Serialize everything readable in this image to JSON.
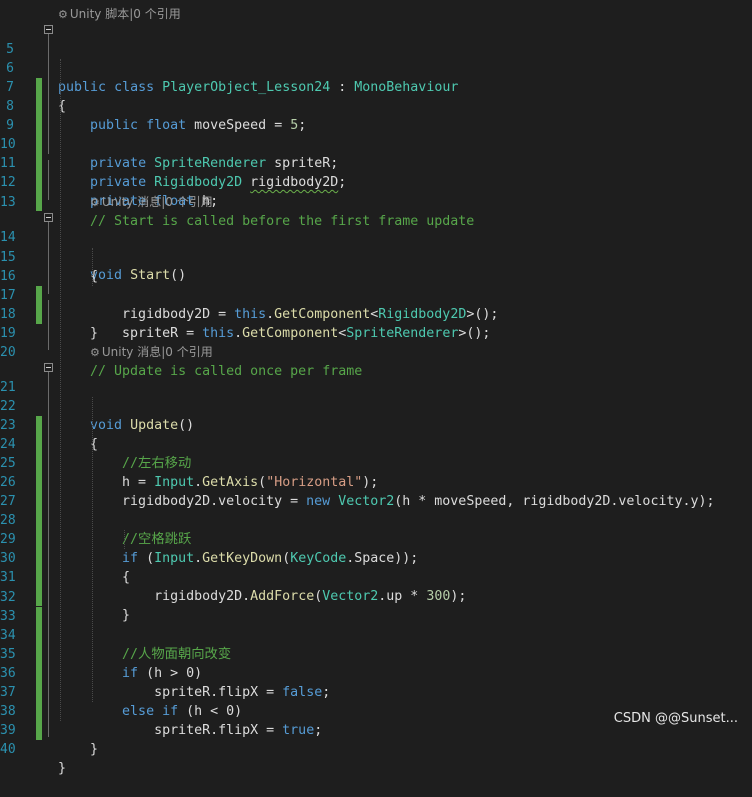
{
  "editor": {
    "lens_class": "Unity 脚本|0 个引用",
    "lens_start": "Unity 消息|0 个引用",
    "lens_update": "Unity 消息|0 个引用",
    "lines": [
      {
        "n": "5"
      },
      {
        "n": "6"
      },
      {
        "n": "7"
      },
      {
        "n": "8"
      },
      {
        "n": "9"
      },
      {
        "n": "10"
      },
      {
        "n": "11"
      },
      {
        "n": "12"
      },
      {
        "n": "13"
      },
      {
        "n": "14"
      },
      {
        "n": "15"
      },
      {
        "n": "16"
      },
      {
        "n": "17"
      },
      {
        "n": "18"
      },
      {
        "n": "19"
      },
      {
        "n": "20"
      },
      {
        "n": "21"
      },
      {
        "n": "22"
      },
      {
        "n": "23"
      },
      {
        "n": "24"
      },
      {
        "n": "25"
      },
      {
        "n": "26"
      },
      {
        "n": "27"
      },
      {
        "n": "28"
      },
      {
        "n": "29"
      },
      {
        "n": "30"
      },
      {
        "n": "31"
      },
      {
        "n": "32"
      },
      {
        "n": "33"
      },
      {
        "n": "34"
      },
      {
        "n": "35"
      },
      {
        "n": "36"
      },
      {
        "n": "37"
      },
      {
        "n": "38"
      },
      {
        "n": "39"
      },
      {
        "n": "40"
      }
    ],
    "tok": {
      "public": "public",
      "class": "class",
      "className": "PlayerObject_Lesson24",
      "colon": " : ",
      "mono": "MonoBehaviour",
      "lbrace": "{",
      "rbrace": "}",
      "float": "float",
      "moveSpeed": "moveSpeed = ",
      "five": "5",
      "semi": ";",
      "private": "private",
      "SpriteRenderer": "SpriteRenderer",
      "spriteR": " spriteR;",
      "Rigidbody2D": "Rigidbody2D",
      "rigidbody2D": "rigidbody2D",
      "h": " h;",
      "c_start": "// Start is called before the first frame update",
      "void": "void",
      "Start": "Start",
      "parens": "()",
      "rb_assign": "rigidbody2D = ",
      "this": "this",
      ".": ".",
      "GetComponent": "GetComponent",
      "lt": "<",
      "gt_call": ">();",
      "sr_assign": "spriteR = ",
      "c_update": "// Update is called once per frame",
      "Update": "Update",
      "c_move": "//左右移动",
      "h_assign": "h = ",
      "Input": "Input",
      "GetAxis": "GetAxis",
      "lp": "(",
      "horizontal": "\"Horizontal\"",
      "rp_semi": ");",
      "rb_vel": "rigidbody2D.velocity = ",
      "new": "new",
      "Vector2": "Vector2",
      "vel_args": "(h * moveSpeed, rigidbody2D.velocity.y);",
      "c_jump": "//空格跳跃",
      "if": "if",
      "sp_lp": " (",
      "GetKeyDown": "GetKeyDown",
      "KeyCode": "KeyCode",
      ".Space": ".Space));",
      "rb_dot": "rigidbody2D.",
      "AddForce": "AddForce",
      "up_mul": ".up * ",
      "n300": "300",
      "rp2": ");",
      "c_face": "//人物面朝向改变",
      "h_gt": " (h > 0)",
      "flip_assign": "spriteR.flipX = ",
      "false": "false",
      "true": "true",
      "else": "else",
      "h_lt": " (h < 0)"
    }
  },
  "watermark": "CSDN @@Sunset..."
}
